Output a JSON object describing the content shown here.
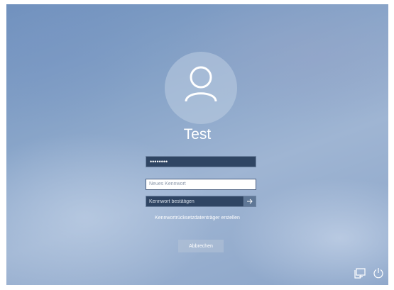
{
  "login": {
    "username": "Test",
    "current_password_mask": "••••••••",
    "new_password_placeholder": "Neues Kennwort",
    "confirm_password_placeholder": "Kennwort bestätigen",
    "submit_icon": "arrow-right-icon",
    "reset_disk_link": "Kennwortrücksetzdatenträger erstellen",
    "cancel_label": "Abbrechen"
  },
  "system_tray": {
    "network_icon": "network-icon",
    "power_icon": "power-icon"
  },
  "colors": {
    "field_dark": "#2f4563",
    "submit_button": "#5f7796",
    "background": "#89a5c9"
  }
}
